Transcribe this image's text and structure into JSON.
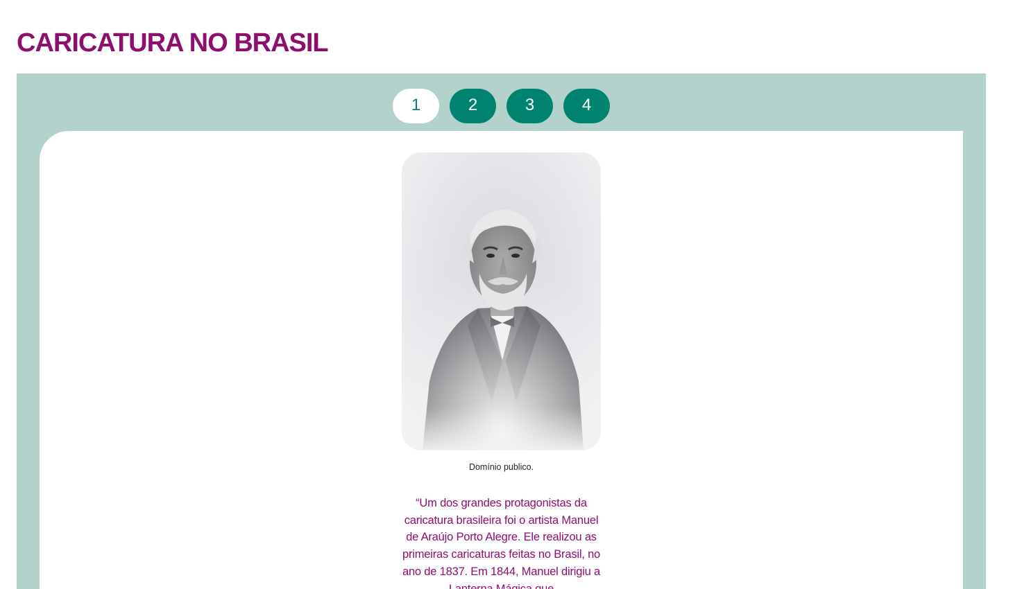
{
  "page": {
    "title": "CARICATURA NO BRASIL"
  },
  "tabs": [
    {
      "label": "1",
      "active": true
    },
    {
      "label": "2",
      "active": false
    },
    {
      "label": "3",
      "active": false
    },
    {
      "label": "4",
      "active": false
    }
  ],
  "slide": {
    "image_icon": "portrait-photo",
    "caption": "Domínio publico.",
    "quote": "“Um dos grandes protagonistas da caricatura brasileira foi o artista Manuel de Araújo Porto Alegre. Ele realizou as primeiras caricaturas feitas no Brasil, no ano de 1837. Em 1844, Manuel dirigiu a Lanterna Mágica que"
  },
  "colors": {
    "title": "#8c0f6e",
    "panel_bg": "#b3d2cc",
    "tab_bg": "#00846f",
    "tab_active_bg": "#ffffff",
    "quote_text": "#8c0f6e"
  }
}
